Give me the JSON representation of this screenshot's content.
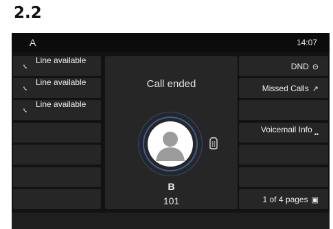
{
  "section_heading": "2.2",
  "status_bar": {
    "account": "A",
    "time": "14:07"
  },
  "line_keys": [
    {
      "label": "Line available",
      "icon": "phone-icon"
    },
    {
      "label": "Line available",
      "icon": "phone-icon"
    },
    {
      "label": "Line available",
      "icon": "phone-icon"
    },
    {
      "label": ""
    },
    {
      "label": ""
    },
    {
      "label": ""
    },
    {
      "label": ""
    }
  ],
  "soft_keys": {
    "dnd": {
      "label": "DND",
      "icon": "dnd-icon"
    },
    "missed_calls": {
      "label": "Missed Calls",
      "icon": "missed-call-icon"
    },
    "voicemail": {
      "label": "Voicemail Info",
      "icon": "voicemail-icon"
    },
    "pages": {
      "label": "1 of 4 pages",
      "icon": "pages-icon"
    }
  },
  "call": {
    "status": "Call ended",
    "contact_name": "B",
    "contact_number": "101"
  },
  "colors": {
    "background": "#121212",
    "key": "#262626",
    "ring": "#3a5f9c",
    "text": "#ededed"
  }
}
